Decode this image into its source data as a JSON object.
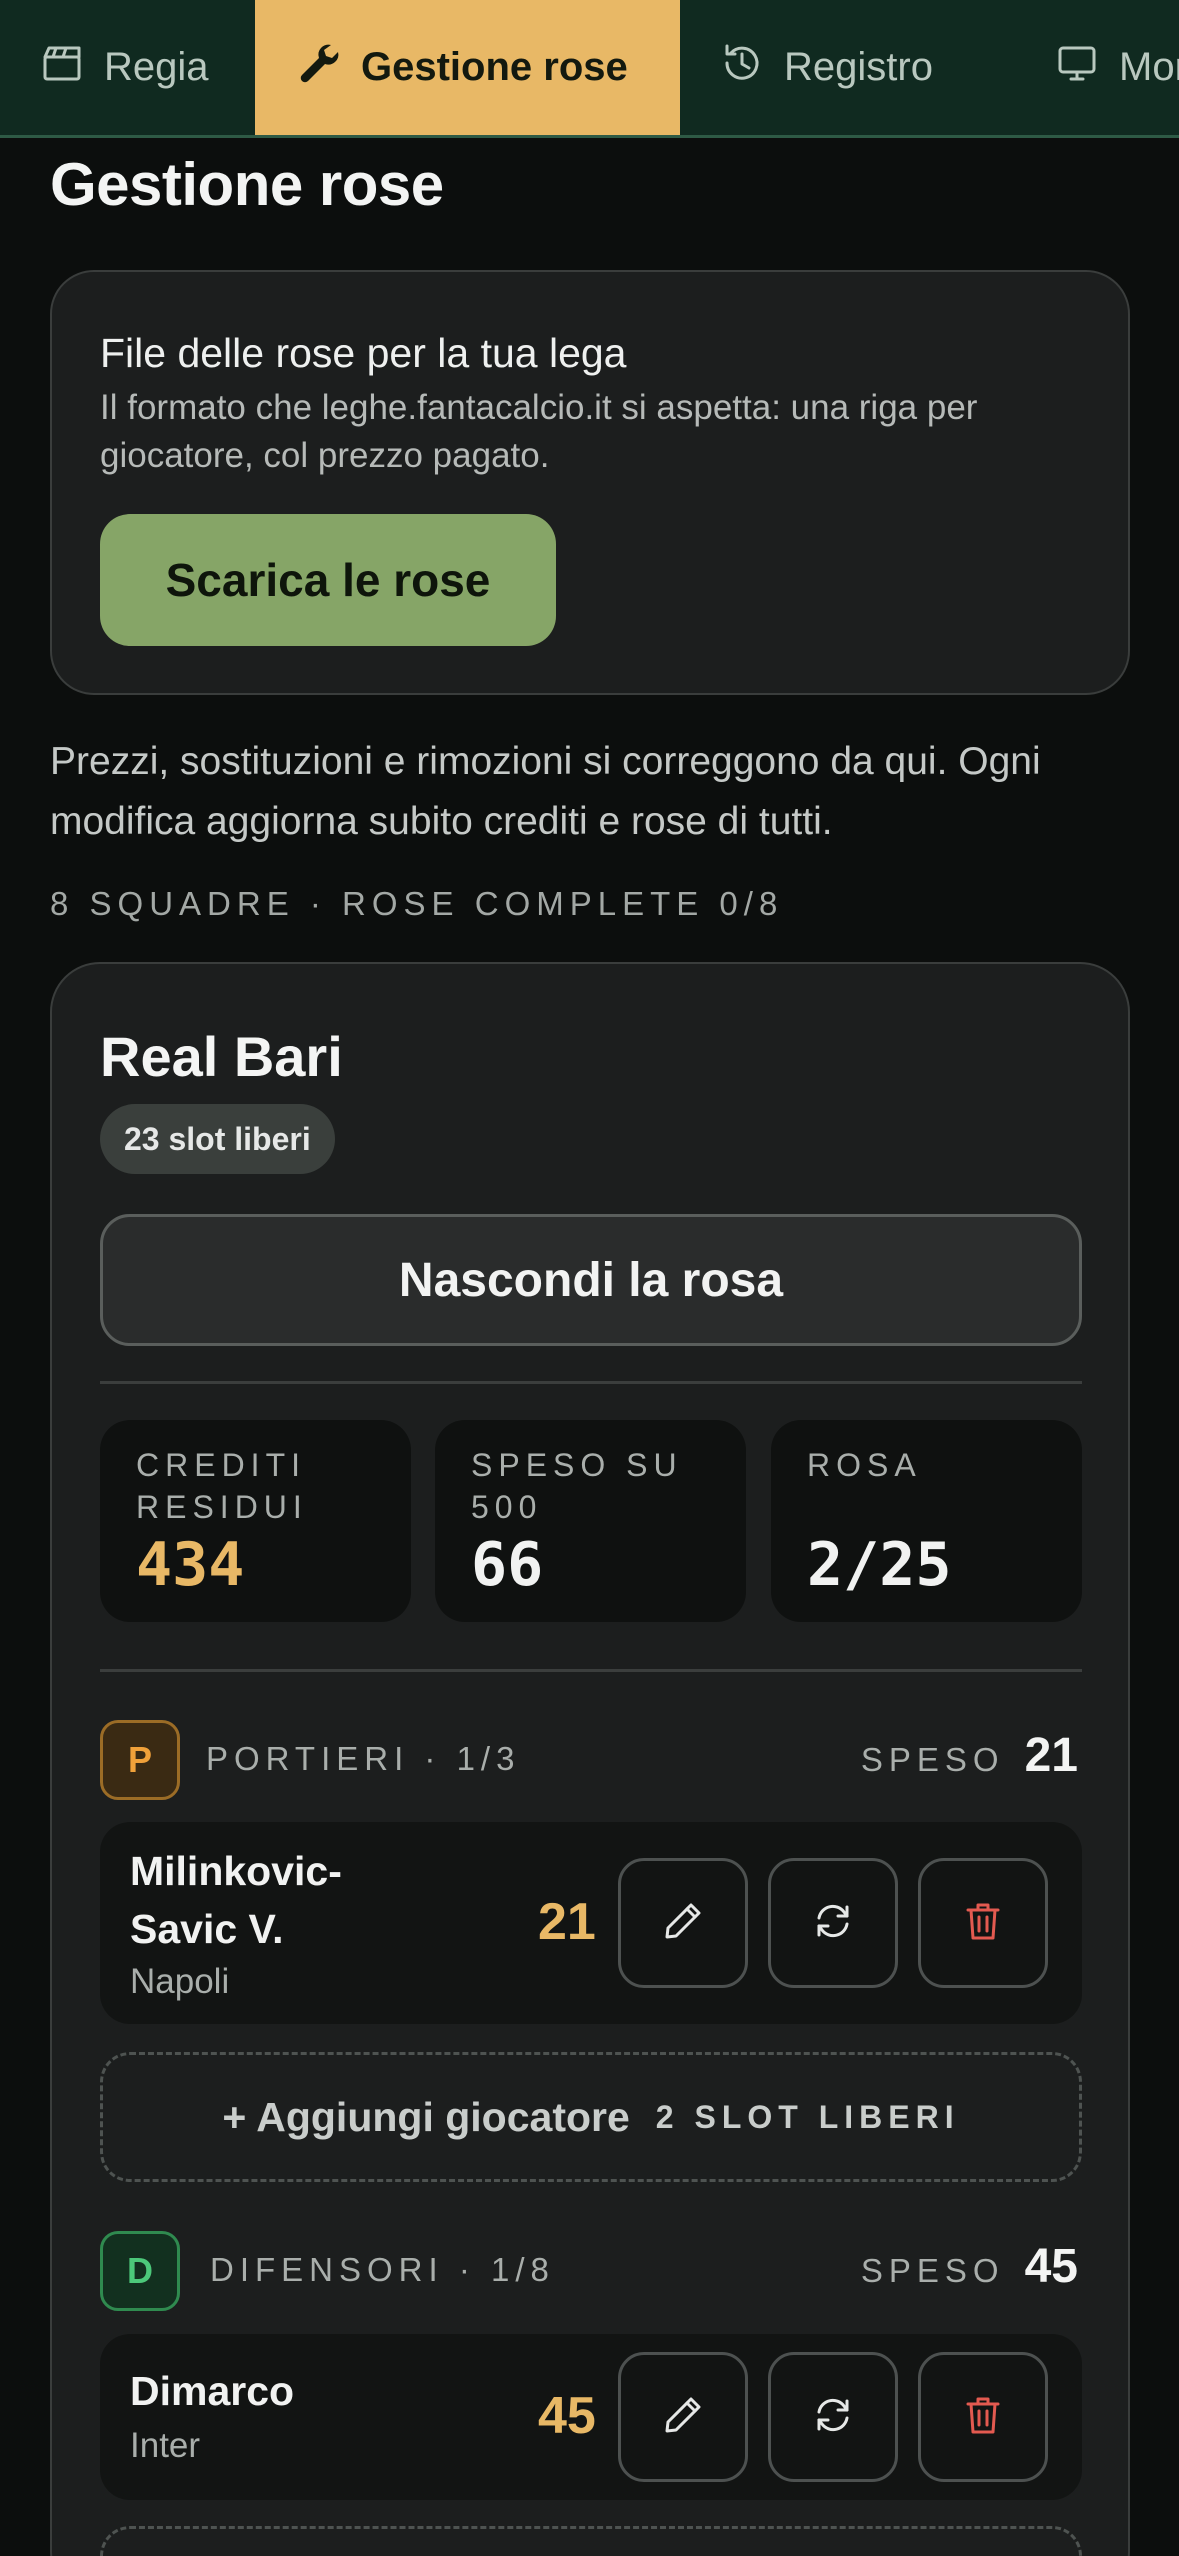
{
  "nav": {
    "tabs": [
      {
        "label": "Regia",
        "icon": "clapperboard-icon"
      },
      {
        "label": "Gestione rose",
        "icon": "wrench-icon",
        "active": true
      },
      {
        "label": "Registro",
        "icon": "history-icon"
      },
      {
        "label": "Mon",
        "icon": "monitor-icon"
      }
    ]
  },
  "page": {
    "title": "Gestione rose",
    "intro": "Prezzi, sostituzioni e rimozioni si correggono da qui. Ogni modifica aggiorna subito crediti e rose di tutti.",
    "meta": "8 squadre · rose complete 0/8"
  },
  "export": {
    "title": "File delle rose per la tua lega",
    "description": "Il formato che leghe.fantacalcio.it si aspetta: una riga per giocatore, col prezzo pagato.",
    "button_label": "Scarica le rose"
  },
  "team": {
    "name": "Real Bari",
    "free_slots": "23 slot liberi",
    "toggle_label": "Nascondi la rosa",
    "stats": {
      "credits_label": "Crediti residui",
      "credits_value": "434",
      "spent_label": "Speso su 500",
      "spent_value": "66",
      "roster_label": "Rosa",
      "roster_value": "2/25"
    },
    "sections": [
      {
        "badge": "P",
        "title": "Portieri · 1/3",
        "spent_label": "Speso",
        "spent_value": "21",
        "players": [
          {
            "name": "Milinkovic-Savic V.",
            "team": "Napoli",
            "price": "21"
          }
        ],
        "add_label": "+ Aggiungi giocatore",
        "add_slots": "2 slot liberi"
      },
      {
        "badge": "D",
        "title": "Difensori · 1/8",
        "spent_label": "Speso",
        "spent_value": "45",
        "players": [
          {
            "name": "Dimarco",
            "team": "Inter",
            "price": "45"
          }
        ]
      }
    ]
  },
  "colors": {
    "accent": "#e8b866",
    "nav_bg": "#102a20",
    "download": "#86a567",
    "danger": "#e35a50"
  }
}
